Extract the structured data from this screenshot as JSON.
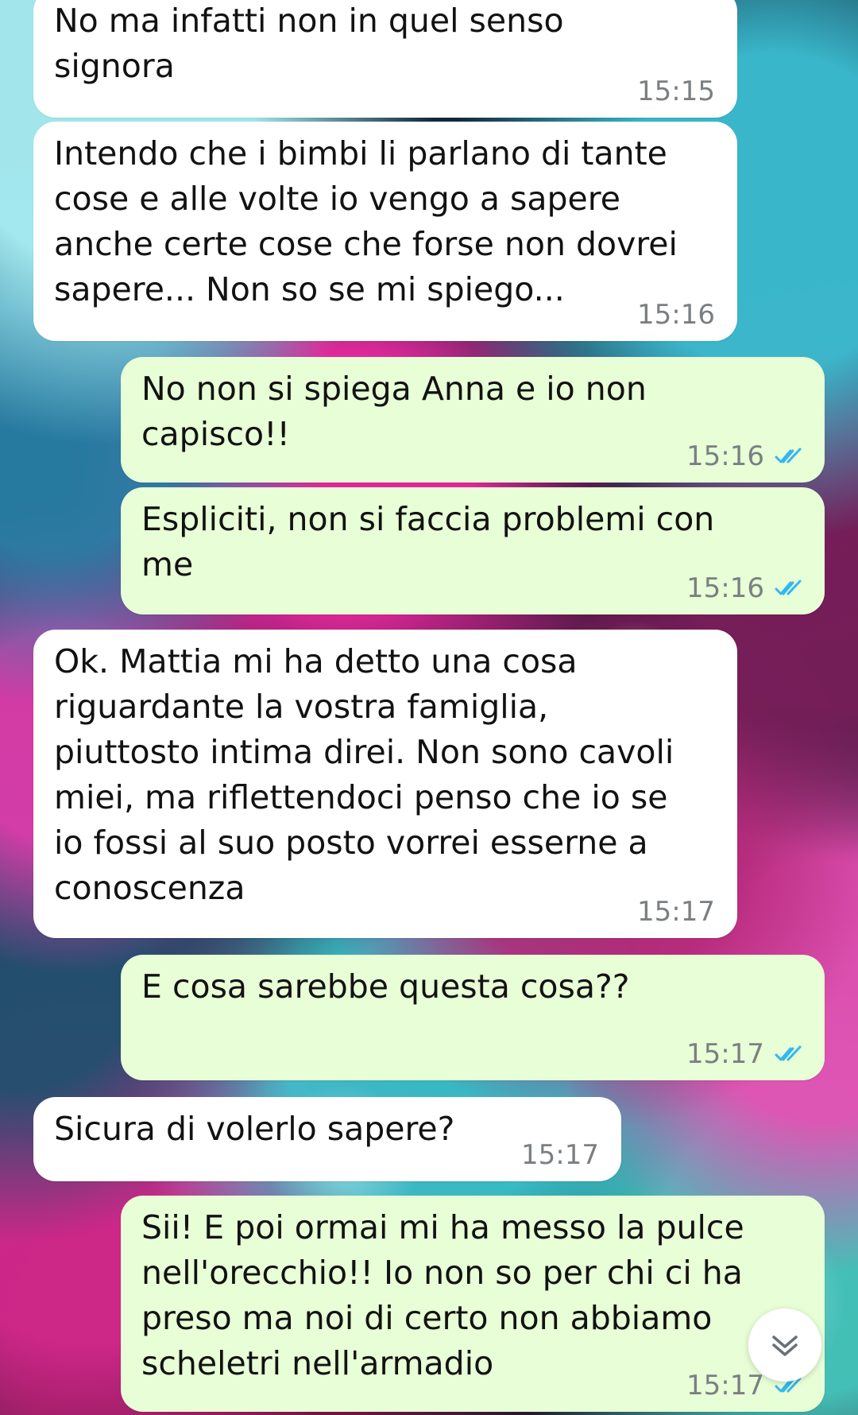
{
  "chat": {
    "messages": [
      {
        "direction": "incoming",
        "text": "No ma infatti non in quel senso\nsignora",
        "time": "15:15"
      },
      {
        "direction": "incoming",
        "text": "Intendo che i bimbi li parlano di tante\ncose e alle volte io vengo a sapere\nanche certe cose che forse non dovrei\nsapere... Non so se mi spiego...",
        "time": "15:16"
      },
      {
        "direction": "outgoing",
        "text": "No non si spiega Anna e io non\ncapisco!!",
        "time": "15:16",
        "status_icon": "double-check-read-icon"
      },
      {
        "direction": "outgoing",
        "text": "Espliciti, non si faccia problemi con\nme",
        "time": "15:16",
        "status_icon": "double-check-read-icon"
      },
      {
        "direction": "incoming",
        "text": "Ok. Mattia mi ha detto una cosa\nriguardante la vostra famiglia,\npiuttosto intima direi. Non sono cavoli\nmiei, ma riflettendoci penso che io se\nio fossi al suo posto vorrei esserne a\nconoscenza",
        "time": "15:17"
      },
      {
        "direction": "outgoing",
        "text": "E cosa sarebbe questa cosa??",
        "time": "15:17",
        "status_icon": "double-check-read-icon"
      },
      {
        "direction": "incoming",
        "text": "Sicura di volerlo sapere?",
        "time": "15:17"
      },
      {
        "direction": "outgoing",
        "text": "Sii! E poi ormai mi ha messo la pulce\nnell'orecchio!! Io non so per chi ci ha\npreso ma noi di certo non abbiamo\nscheletri nell'armadio",
        "time": "15:17",
        "status_icon": "double-check-read-icon"
      }
    ],
    "scroll_button_icon": "chevron-down-double-icon"
  },
  "theme": {
    "incoming_bubble": "#ffffff",
    "outgoing_bubble": "#e7fed6",
    "time_color": "#7b7f82",
    "read_tick_color": "#34b7f1"
  }
}
